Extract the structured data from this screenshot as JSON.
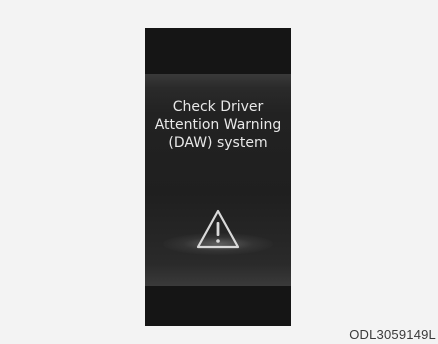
{
  "display": {
    "message_lines": [
      "Check Driver",
      "Attention Warning",
      "(DAW) system"
    ],
    "icon": "warning-triangle-icon"
  },
  "caption": {
    "reference_code": "ODL3059149L"
  },
  "colors": {
    "page_background": "#f3f3f3",
    "panel_dark": "#161616",
    "text": "#e8e8e8"
  }
}
